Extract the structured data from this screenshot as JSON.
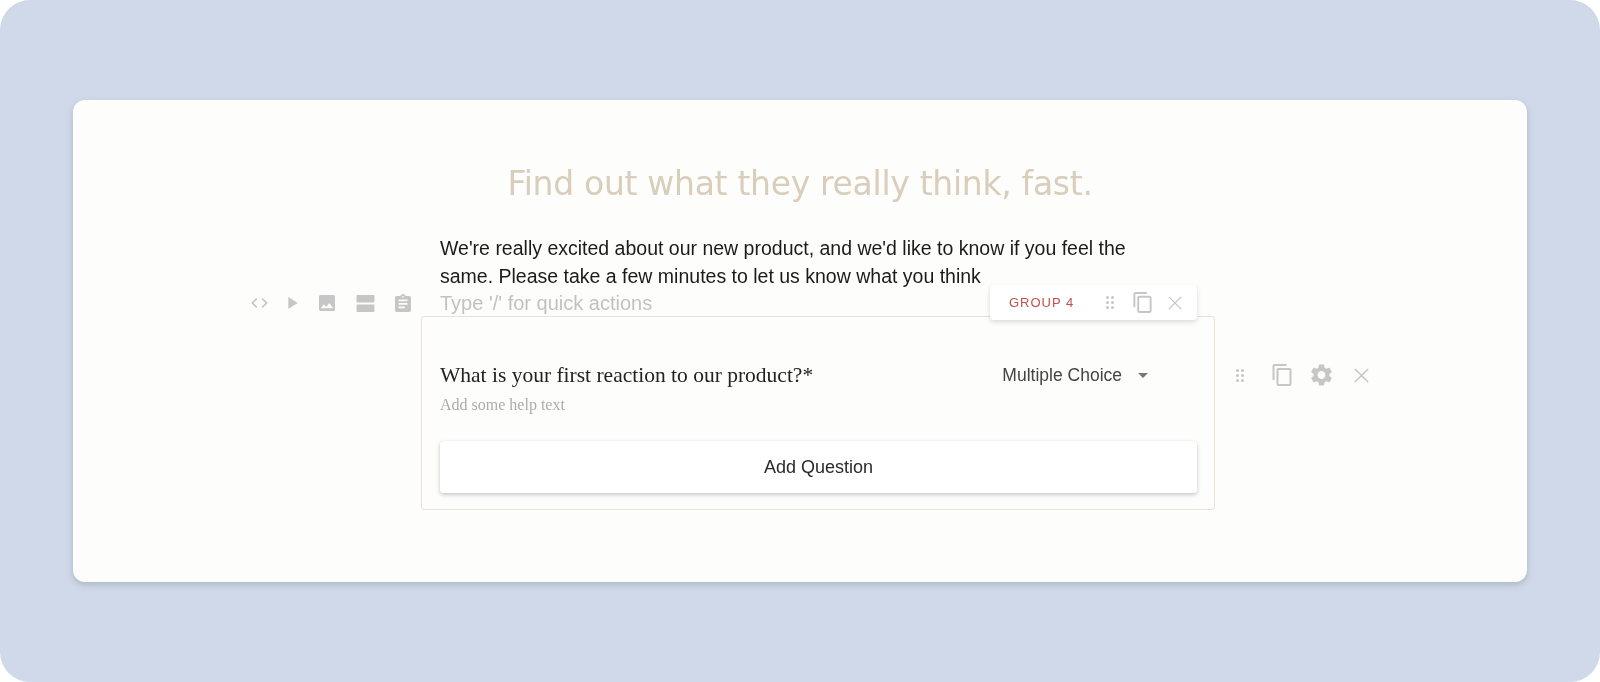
{
  "heading": {
    "title": "Find out what they really think, fast.",
    "intro": "We're really excited about our new product, and we'd like to know if you feel the same. Please take a few minutes to let us know what you think"
  },
  "quick_actions": {
    "placeholder": "Type '/' for quick actions"
  },
  "group": {
    "label": "GROUP 4"
  },
  "question": {
    "text": "What is your first reaction to our product?*",
    "type": "Multiple Choice",
    "help_text": {
      "placeholder": "Add some help text"
    }
  },
  "add_button": {
    "label": "Add Question"
  }
}
